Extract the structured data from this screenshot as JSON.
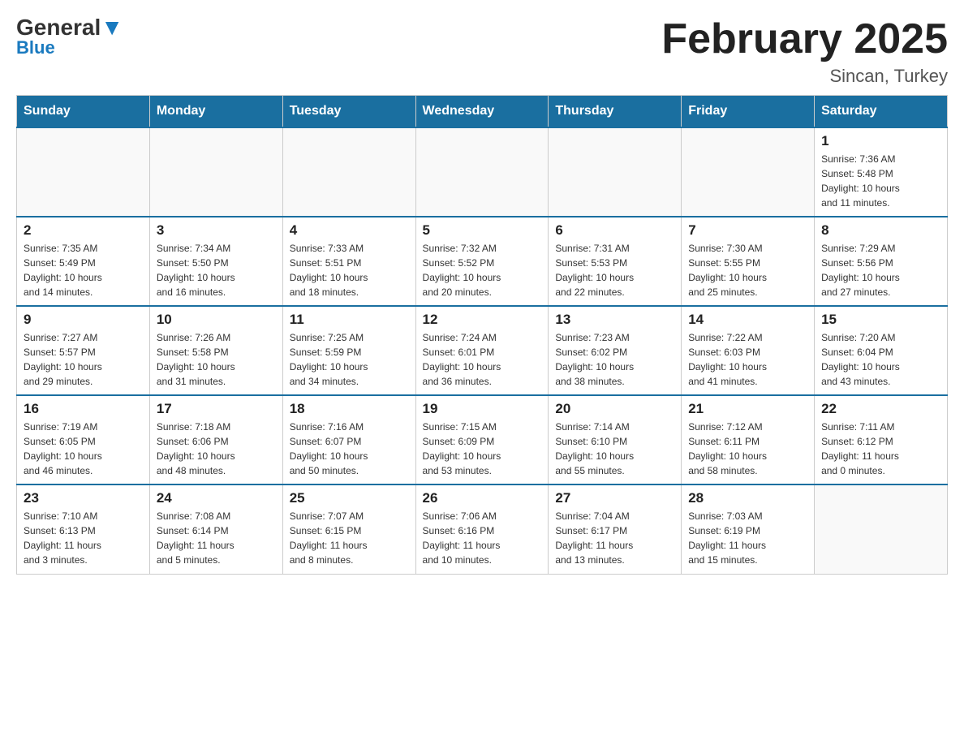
{
  "header": {
    "logo_general": "General",
    "logo_blue": "Blue",
    "month_title": "February 2025",
    "location": "Sincan, Turkey"
  },
  "days_of_week": [
    "Sunday",
    "Monday",
    "Tuesday",
    "Wednesday",
    "Thursday",
    "Friday",
    "Saturday"
  ],
  "weeks": [
    [
      {
        "day": "",
        "info": ""
      },
      {
        "day": "",
        "info": ""
      },
      {
        "day": "",
        "info": ""
      },
      {
        "day": "",
        "info": ""
      },
      {
        "day": "",
        "info": ""
      },
      {
        "day": "",
        "info": ""
      },
      {
        "day": "1",
        "info": "Sunrise: 7:36 AM\nSunset: 5:48 PM\nDaylight: 10 hours\nand 11 minutes."
      }
    ],
    [
      {
        "day": "2",
        "info": "Sunrise: 7:35 AM\nSunset: 5:49 PM\nDaylight: 10 hours\nand 14 minutes."
      },
      {
        "day": "3",
        "info": "Sunrise: 7:34 AM\nSunset: 5:50 PM\nDaylight: 10 hours\nand 16 minutes."
      },
      {
        "day": "4",
        "info": "Sunrise: 7:33 AM\nSunset: 5:51 PM\nDaylight: 10 hours\nand 18 minutes."
      },
      {
        "day": "5",
        "info": "Sunrise: 7:32 AM\nSunset: 5:52 PM\nDaylight: 10 hours\nand 20 minutes."
      },
      {
        "day": "6",
        "info": "Sunrise: 7:31 AM\nSunset: 5:53 PM\nDaylight: 10 hours\nand 22 minutes."
      },
      {
        "day": "7",
        "info": "Sunrise: 7:30 AM\nSunset: 5:55 PM\nDaylight: 10 hours\nand 25 minutes."
      },
      {
        "day": "8",
        "info": "Sunrise: 7:29 AM\nSunset: 5:56 PM\nDaylight: 10 hours\nand 27 minutes."
      }
    ],
    [
      {
        "day": "9",
        "info": "Sunrise: 7:27 AM\nSunset: 5:57 PM\nDaylight: 10 hours\nand 29 minutes."
      },
      {
        "day": "10",
        "info": "Sunrise: 7:26 AM\nSunset: 5:58 PM\nDaylight: 10 hours\nand 31 minutes."
      },
      {
        "day": "11",
        "info": "Sunrise: 7:25 AM\nSunset: 5:59 PM\nDaylight: 10 hours\nand 34 minutes."
      },
      {
        "day": "12",
        "info": "Sunrise: 7:24 AM\nSunset: 6:01 PM\nDaylight: 10 hours\nand 36 minutes."
      },
      {
        "day": "13",
        "info": "Sunrise: 7:23 AM\nSunset: 6:02 PM\nDaylight: 10 hours\nand 38 minutes."
      },
      {
        "day": "14",
        "info": "Sunrise: 7:22 AM\nSunset: 6:03 PM\nDaylight: 10 hours\nand 41 minutes."
      },
      {
        "day": "15",
        "info": "Sunrise: 7:20 AM\nSunset: 6:04 PM\nDaylight: 10 hours\nand 43 minutes."
      }
    ],
    [
      {
        "day": "16",
        "info": "Sunrise: 7:19 AM\nSunset: 6:05 PM\nDaylight: 10 hours\nand 46 minutes."
      },
      {
        "day": "17",
        "info": "Sunrise: 7:18 AM\nSunset: 6:06 PM\nDaylight: 10 hours\nand 48 minutes."
      },
      {
        "day": "18",
        "info": "Sunrise: 7:16 AM\nSunset: 6:07 PM\nDaylight: 10 hours\nand 50 minutes."
      },
      {
        "day": "19",
        "info": "Sunrise: 7:15 AM\nSunset: 6:09 PM\nDaylight: 10 hours\nand 53 minutes."
      },
      {
        "day": "20",
        "info": "Sunrise: 7:14 AM\nSunset: 6:10 PM\nDaylight: 10 hours\nand 55 minutes."
      },
      {
        "day": "21",
        "info": "Sunrise: 7:12 AM\nSunset: 6:11 PM\nDaylight: 10 hours\nand 58 minutes."
      },
      {
        "day": "22",
        "info": "Sunrise: 7:11 AM\nSunset: 6:12 PM\nDaylight: 11 hours\nand 0 minutes."
      }
    ],
    [
      {
        "day": "23",
        "info": "Sunrise: 7:10 AM\nSunset: 6:13 PM\nDaylight: 11 hours\nand 3 minutes."
      },
      {
        "day": "24",
        "info": "Sunrise: 7:08 AM\nSunset: 6:14 PM\nDaylight: 11 hours\nand 5 minutes."
      },
      {
        "day": "25",
        "info": "Sunrise: 7:07 AM\nSunset: 6:15 PM\nDaylight: 11 hours\nand 8 minutes."
      },
      {
        "day": "26",
        "info": "Sunrise: 7:06 AM\nSunset: 6:16 PM\nDaylight: 11 hours\nand 10 minutes."
      },
      {
        "day": "27",
        "info": "Sunrise: 7:04 AM\nSunset: 6:17 PM\nDaylight: 11 hours\nand 13 minutes."
      },
      {
        "day": "28",
        "info": "Sunrise: 7:03 AM\nSunset: 6:19 PM\nDaylight: 11 hours\nand 15 minutes."
      },
      {
        "day": "",
        "info": ""
      }
    ]
  ]
}
